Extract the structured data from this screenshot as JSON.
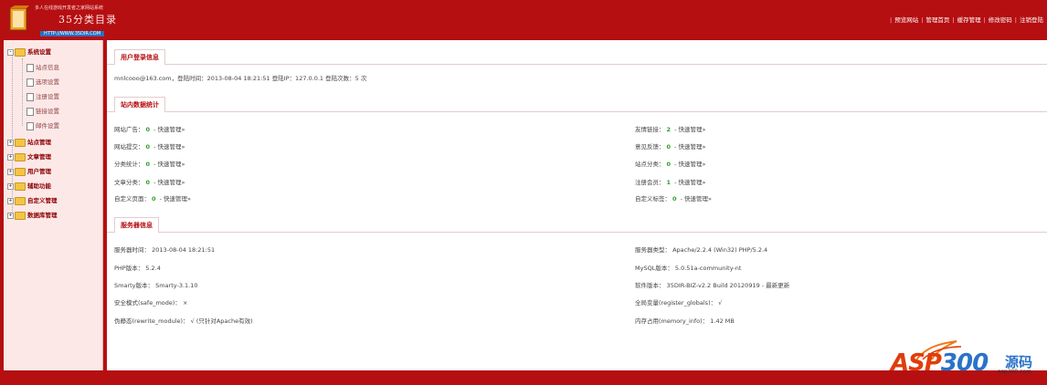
{
  "header": {
    "slogan": "多人在线游戏开发者之家网站系统",
    "logo_name": "35分类目录",
    "logo_url": "HTTP://WWW.35DIR.COM",
    "nav": [
      "预览网站",
      "管理首页",
      "缓存管理",
      "修改密码",
      "注销登陆"
    ]
  },
  "sidebar": {
    "root_open": {
      "label": "系统设置",
      "toggle": "-"
    },
    "sub_items": [
      "站点信息",
      "选项设置",
      "注册设置",
      "链接设置",
      "邮件设置"
    ],
    "roots": [
      {
        "label": "站点管理",
        "toggle": "+"
      },
      {
        "label": "文章管理",
        "toggle": "+"
      },
      {
        "label": "用户管理",
        "toggle": "+"
      },
      {
        "label": "辅助功能",
        "toggle": "+"
      },
      {
        "label": "自定义管理",
        "toggle": "+"
      },
      {
        "label": "数据库管理",
        "toggle": "+"
      }
    ]
  },
  "sections": {
    "login": {
      "title": "用户登录信息",
      "text": "mnlcooo@163.com，登陆时间：2013-08-04 18:21:51   登陆IP：127.0.0.1   登陆次数：5 次"
    },
    "stats": {
      "title": "站内数据统计",
      "manage": "快速管理»",
      "left": [
        {
          "label": "网站广告：",
          "value": "0"
        },
        {
          "label": "网站提交：",
          "value": "0"
        },
        {
          "label": "分类统计：",
          "value": "0"
        },
        {
          "label": "文章分类：",
          "value": "0"
        },
        {
          "label": "自定义页面：",
          "value": "0"
        }
      ],
      "right": [
        {
          "label": "友情链接：",
          "value": "2"
        },
        {
          "label": "意见反馈：",
          "value": "0"
        },
        {
          "label": "站点分类：",
          "value": "0"
        },
        {
          "label": "注册会员：",
          "value": "1"
        },
        {
          "label": "自定义标签：",
          "value": "0"
        }
      ]
    },
    "server": {
      "title": "服务器信息",
      "left": [
        "服务器时间：  2013-08-04   18:21:51",
        "PHP版本：   5.2.4",
        "Smarty版本：  Smarty-3.1.10",
        "安全模式(safe_mode)：   ×",
        "伪静态(rewrite_module)：   √ (只针对Apache有效)"
      ],
      "right": [
        "服务器类型：  Apache/2.2.4 (Win32) PHP/5.2.4",
        "MySQL版本：   5.0.51a-community-nt",
        "软件版本：   35DIR-BIZ-v2.2 Build 20120919 - 最新更新",
        "全局变量(register_globals)：   √",
        "内存占用(memory_info)：   1.42 MB"
      ]
    }
  },
  "watermark": {
    "brand_a": "ASP",
    "brand_b": "300",
    "cn": "源码",
    "url": "asp300.com"
  },
  "colors": {
    "primary": "#b50f12",
    "sidebar": "#fde8e8",
    "value_green": "#2a9d2a"
  }
}
